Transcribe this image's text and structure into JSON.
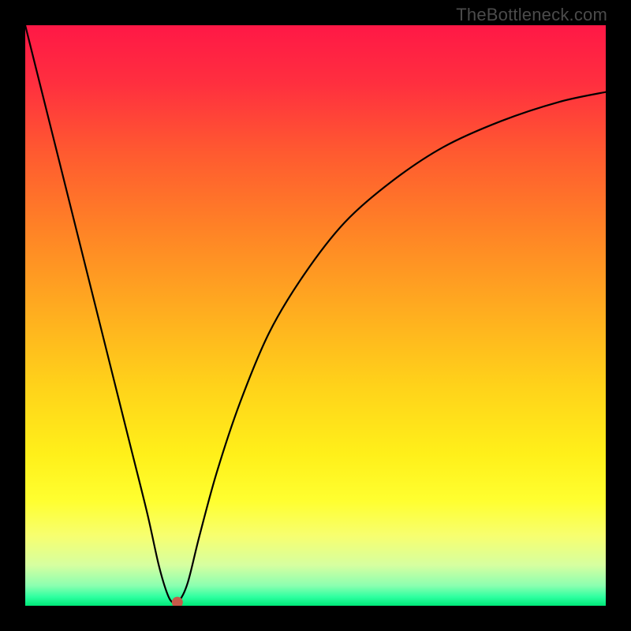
{
  "watermark": "TheBottleneck.com",
  "chart_data": {
    "type": "line",
    "title": "",
    "xlabel": "",
    "ylabel": "",
    "xlim": [
      0,
      100
    ],
    "ylim": [
      0,
      100
    ],
    "background_gradient": {
      "stops": [
        {
          "offset": 0.0,
          "color": "#ff1846"
        },
        {
          "offset": 0.1,
          "color": "#ff2f3f"
        },
        {
          "offset": 0.22,
          "color": "#ff5a30"
        },
        {
          "offset": 0.35,
          "color": "#ff8226"
        },
        {
          "offset": 0.5,
          "color": "#ffaf1f"
        },
        {
          "offset": 0.62,
          "color": "#ffd21a"
        },
        {
          "offset": 0.74,
          "color": "#fff01a"
        },
        {
          "offset": 0.82,
          "color": "#ffff30"
        },
        {
          "offset": 0.88,
          "color": "#f7ff70"
        },
        {
          "offset": 0.93,
          "color": "#d6ffa0"
        },
        {
          "offset": 0.965,
          "color": "#8cffb0"
        },
        {
          "offset": 0.985,
          "color": "#2dffa0"
        },
        {
          "offset": 1.0,
          "color": "#00e878"
        }
      ]
    },
    "series": [
      {
        "name": "bottleneck-curve",
        "x": [
          0,
          3,
          6,
          9,
          12,
          15,
          18,
          21,
          23,
          24.5,
          25.5,
          26.5,
          28,
          30,
          33,
          37,
          42,
          48,
          55,
          63,
          72,
          82,
          92,
          100
        ],
        "y": [
          100,
          88,
          76,
          64,
          52,
          40,
          28,
          16,
          7,
          2,
          0.5,
          0.8,
          4,
          12,
          23,
          35,
          47,
          57,
          66,
          73,
          79,
          83.5,
          86.8,
          88.5
        ]
      }
    ],
    "marker": {
      "x": 26.2,
      "y": 0.6,
      "color": "#c75a4a",
      "radius_pct": 0.95
    }
  }
}
